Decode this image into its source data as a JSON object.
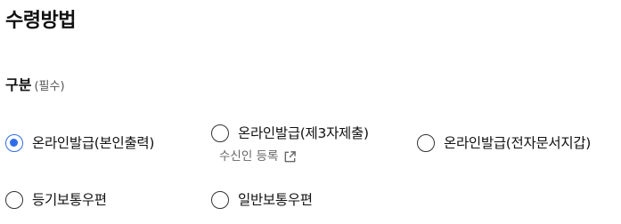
{
  "section_title": "수령방법",
  "group": {
    "label": "구분",
    "required_note": "(필수)"
  },
  "options": [
    {
      "label": "온라인발급(본인출력)",
      "checked": true
    },
    {
      "label": "온라인발급(제3자제출)",
      "checked": false
    },
    {
      "label": "온라인발급(전자문서지갑)",
      "checked": false
    },
    {
      "label": "등기보통우편",
      "checked": false
    },
    {
      "label": "일반보통우편",
      "checked": false
    }
  ],
  "recipient_link": {
    "label": "수신인 등록",
    "icon": "external-link-icon"
  },
  "colors": {
    "accent": "#2f6ee8",
    "text": "#111111",
    "muted": "#666666"
  }
}
